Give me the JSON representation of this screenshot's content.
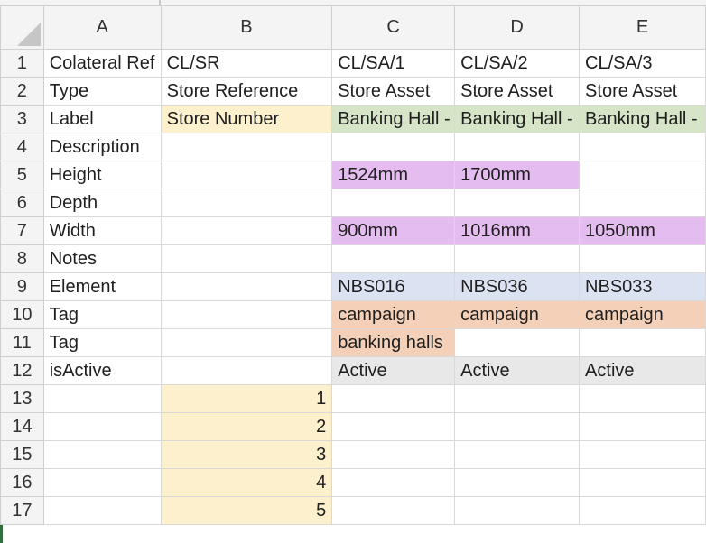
{
  "columns": [
    "A",
    "B",
    "C",
    "D",
    "E"
  ],
  "rows": [
    {
      "n": "1",
      "a": "Colateral Ref",
      "b": "CL/SR",
      "c": "CL/SA/1",
      "d": "CL/SA/2",
      "e": "CL/SA/3"
    },
    {
      "n": "2",
      "a": "Type",
      "b": "Store Reference",
      "c": "Store Asset",
      "d": "Store Asset",
      "e": "Store Asset"
    },
    {
      "n": "3",
      "a": "Label",
      "b": "Store Number",
      "c": "Banking Hall - ",
      "d": "Banking Hall - ",
      "e": "Banking Hall - "
    },
    {
      "n": "4",
      "a": "Description",
      "b": "",
      "c": "",
      "d": "",
      "e": ""
    },
    {
      "n": "5",
      "a": "Height",
      "b": "",
      "c": "1524mm",
      "d": "1700mm",
      "e": ""
    },
    {
      "n": "6",
      "a": "Depth",
      "b": "",
      "c": "",
      "d": "",
      "e": ""
    },
    {
      "n": "7",
      "a": "Width",
      "b": "",
      "c": "900mm",
      "d": "1016mm",
      "e": "1050mm"
    },
    {
      "n": "8",
      "a": "Notes",
      "b": "",
      "c": "",
      "d": "",
      "e": ""
    },
    {
      "n": "9",
      "a": "Element",
      "b": "",
      "c": "NBS016",
      "d": "NBS036",
      "e": "NBS033"
    },
    {
      "n": "10",
      "a": "Tag",
      "b": "",
      "c": "campaign",
      "d": "campaign",
      "e": "campaign"
    },
    {
      "n": "11",
      "a": "Tag",
      "b": "",
      "c": "banking halls",
      "d": "",
      "e": ""
    },
    {
      "n": "12",
      "a": "isActive",
      "b": "",
      "c": "Active",
      "d": "Active",
      "e": "Active"
    },
    {
      "n": "13",
      "a": "",
      "b": "1",
      "c": "",
      "d": "",
      "e": ""
    },
    {
      "n": "14",
      "a": "",
      "b": "2",
      "c": "",
      "d": "",
      "e": ""
    },
    {
      "n": "15",
      "a": "",
      "b": "3",
      "c": "",
      "d": "",
      "e": ""
    },
    {
      "n": "16",
      "a": "",
      "b": "4",
      "c": "",
      "d": "",
      "e": ""
    },
    {
      "n": "17",
      "a": "",
      "b": "5",
      "c": "",
      "d": "",
      "e": ""
    }
  ],
  "colors": {
    "yellow": "#fdf0cd",
    "green": "#d6e5c8",
    "purple": "#e4bcef",
    "blue": "#dbe2f1",
    "salmon": "#f4d0b8",
    "grey": "#e8e8e8"
  }
}
